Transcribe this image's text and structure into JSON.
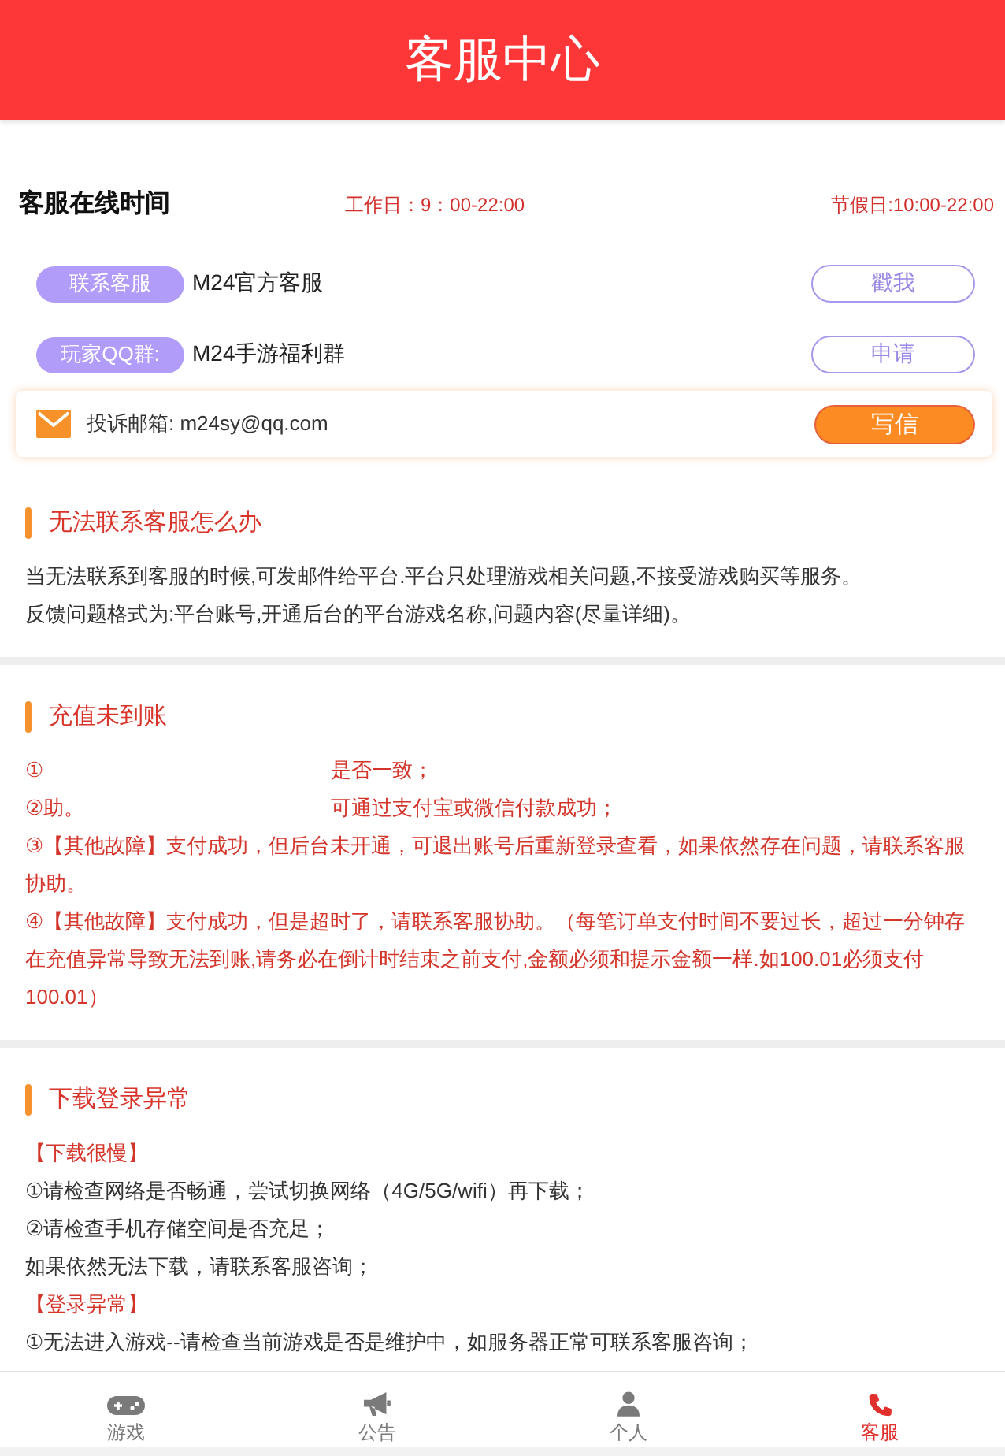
{
  "header": {
    "title": "客服中心"
  },
  "online_hours": {
    "title": "客服在线时间",
    "workday": "工作日：9：00-22:00",
    "holiday": "节假日:10:00-22:00"
  },
  "contacts": [
    {
      "kind": "pill",
      "tag": "联系客服",
      "name": "M24官方客服",
      "button": "戳我"
    },
    {
      "kind": "pill",
      "tag": "玩家QQ群:",
      "name": "M24手游福利群",
      "button": "申请"
    },
    {
      "kind": "mail",
      "label": "投诉邮箱: m24sy@qq.com",
      "button": "写信"
    }
  ],
  "sections": [
    {
      "title": "无法联系客服怎么办",
      "lines": [
        {
          "kind": "plain",
          "text": "当无法联系到客服的时候,可发邮件给平台.平台只处理游戏相关问题,不接受游戏购买等服务。"
        },
        {
          "kind": "plain",
          "text": "反馈问题格式为:平台账号,开通后台的平台游戏名称,问题内容(尽量详细)。"
        }
      ]
    },
    {
      "title": "充值未到账",
      "lines": [
        {
          "kind": "redacted",
          "parts": [
            "①",
            "是否一致；"
          ]
        },
        {
          "kind": "redacted",
          "parts": [
            "②助。",
            "可通过支付宝或微信付款成功；"
          ]
        },
        {
          "kind": "alert",
          "text": "③【其他故障】支付成功，但后台未开通，可退出账号后重新登录查看，如果依然存在问题，请联系客服协助。"
        },
        {
          "kind": "alert",
          "text": "④【其他故障】支付成功，但是超时了，请联系客服协助。（每笔订单支付时间不要过长，超过一分钟存在充值异常导致无法到账,请务必在倒计时结束之前支付,金额必须和提示金额一样.如100.01必须支付100.01）"
        }
      ]
    },
    {
      "title": "下载登录异常",
      "lines": [
        {
          "kind": "subheading",
          "text": "【下载很慢】"
        },
        {
          "kind": "plain",
          "text": "①请检查网络是否畅通，尝试切换网络（4G/5G/wifi）再下载；"
        },
        {
          "kind": "plain",
          "text": "②请检查手机存储空间是否充足；"
        },
        {
          "kind": "plain",
          "text": "如果依然无法下载，请联系客服咨询；"
        },
        {
          "kind": "subheading",
          "text": "【登录异常】"
        },
        {
          "kind": "plain",
          "text": "①无法进入游戏--请检查当前游戏是否是维护中，如服务器正常可联系客服咨询；"
        }
      ]
    }
  ],
  "bottom_nav": [
    {
      "label": "游戏",
      "selected": false
    },
    {
      "label": "公告",
      "selected": false
    },
    {
      "label": "个人",
      "selected": false
    },
    {
      "label": "客服",
      "selected": true
    }
  ]
}
